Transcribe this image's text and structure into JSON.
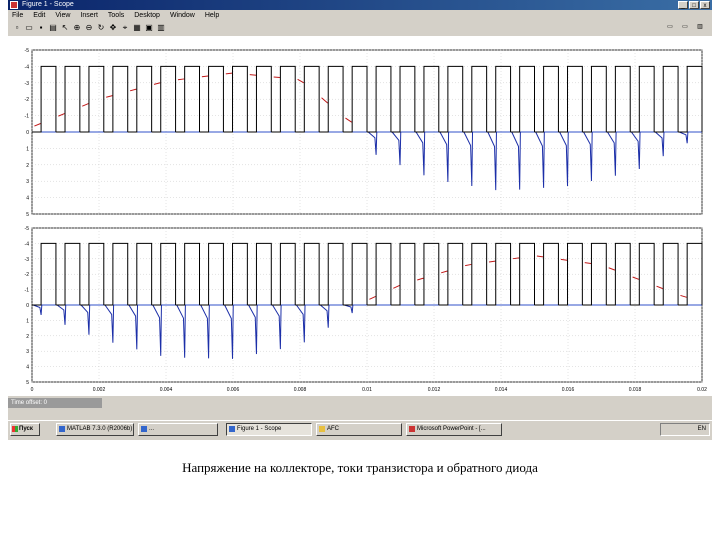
{
  "window": {
    "title": "Figure 1 - Scope",
    "buttons": [
      "_",
      "□",
      "x"
    ]
  },
  "menu": [
    "File",
    "Edit",
    "View",
    "Insert",
    "Tools",
    "Desktop",
    "Window",
    "Help"
  ],
  "toolbar_icons": [
    "new-icon",
    "open-icon",
    "save-icon",
    "print-icon",
    "arrow-icon",
    "zoom-in-icon",
    "zoom-out-icon",
    "rotate-icon",
    "pan-icon",
    "datacursor-icon",
    "insert-icon",
    "legend-icon",
    "grid-icon"
  ],
  "status": {
    "text": "Time offset: 0"
  },
  "taskbar": {
    "start_label": "Пуск",
    "tasks": [
      {
        "label": "MATLAB 7.3.0 (R2006b)",
        "active": false
      },
      {
        "label": "...",
        "active": false
      },
      {
        "label": "Figure 1 - Scope",
        "active": true
      },
      {
        "label": "AFC",
        "active": false
      },
      {
        "label": "Microsoft PowerPoint - [...",
        "active": false
      }
    ],
    "tray": "EN"
  },
  "caption": "Напряжение на коллекторе, токи транзистора и обратного диода",
  "colors": {
    "voltage": "#000000",
    "diode_current": "#1c2fa8",
    "transistor_current": "#c01818",
    "zero_line": "#3050c8"
  },
  "chart_data": [
    {
      "type": "line",
      "title": "",
      "xlabel": "",
      "ylabel": "",
      "xlim": [
        0,
        0.02
      ],
      "ylim": [
        -5,
        5
      ],
      "yticks": [
        -5,
        -4,
        -3,
        -2,
        -1,
        0,
        1,
        2,
        3,
        4,
        5
      ],
      "ytick_labels": [
        "5",
        "4",
        "3",
        "2",
        "1",
        "0",
        "-1",
        "-2",
        "-3",
        "-4",
        "-5"
      ],
      "grid": true,
      "pulse_count": 28,
      "pulse_duty": 0.62,
      "series": [
        {
          "role": "collector_voltage",
          "high": 4,
          "low": 0
        },
        {
          "role": "transistor_current",
          "x": [
            0.0,
            0.002,
            0.004,
            0.006,
            0.008,
            0.0095
          ],
          "y": [
            0.3,
            2.0,
            3.1,
            3.6,
            3.2,
            0.6
          ]
        },
        {
          "role": "diode_current",
          "x": [
            0.0095,
            0.0105,
            0.012,
            0.014,
            0.016,
            0.018,
            0.02
          ],
          "y": [
            -0.7,
            -1.6,
            -2.9,
            -3.6,
            -3.3,
            -2.4,
            -0.2
          ]
        }
      ]
    },
    {
      "type": "line",
      "title": "",
      "xlabel": "",
      "ylabel": "",
      "xlim": [
        0,
        0.02
      ],
      "ylim": [
        -5,
        5
      ],
      "yticks": [
        -5,
        -4,
        -3,
        -2,
        -1,
        0,
        1,
        2,
        3,
        4,
        5
      ],
      "ytick_labels": [
        "5",
        "4",
        "3",
        "2",
        "1",
        "0",
        "-1",
        "-2",
        "-3",
        "-4",
        "-5"
      ],
      "xticks": [
        0,
        0.002,
        0.004,
        0.006,
        0.008,
        0.01,
        0.012,
        0.014,
        0.016,
        0.018,
        0.02
      ],
      "xtick_labels": [
        "0",
        "0.002",
        "0.004",
        "0.006",
        "0.008",
        "0.01",
        "0.012",
        "0.014",
        "0.016",
        "0.018",
        "0.02"
      ],
      "grid": true,
      "pulse_count": 28,
      "pulse_duty": 0.62,
      "series": [
        {
          "role": "collector_voltage",
          "high": 4,
          "low": 0
        },
        {
          "role": "diode_current",
          "x": [
            0.0,
            0.002,
            0.004,
            0.006,
            0.008,
            0.0098
          ],
          "y": [
            -0.4,
            -2.2,
            -3.4,
            -3.5,
            -2.6,
            -0.2
          ]
        },
        {
          "role": "transistor_current",
          "x": [
            0.0098,
            0.011,
            0.013,
            0.015,
            0.017,
            0.0195
          ],
          "y": [
            0.1,
            1.3,
            2.6,
            3.2,
            2.6,
            0.5
          ]
        }
      ]
    }
  ]
}
